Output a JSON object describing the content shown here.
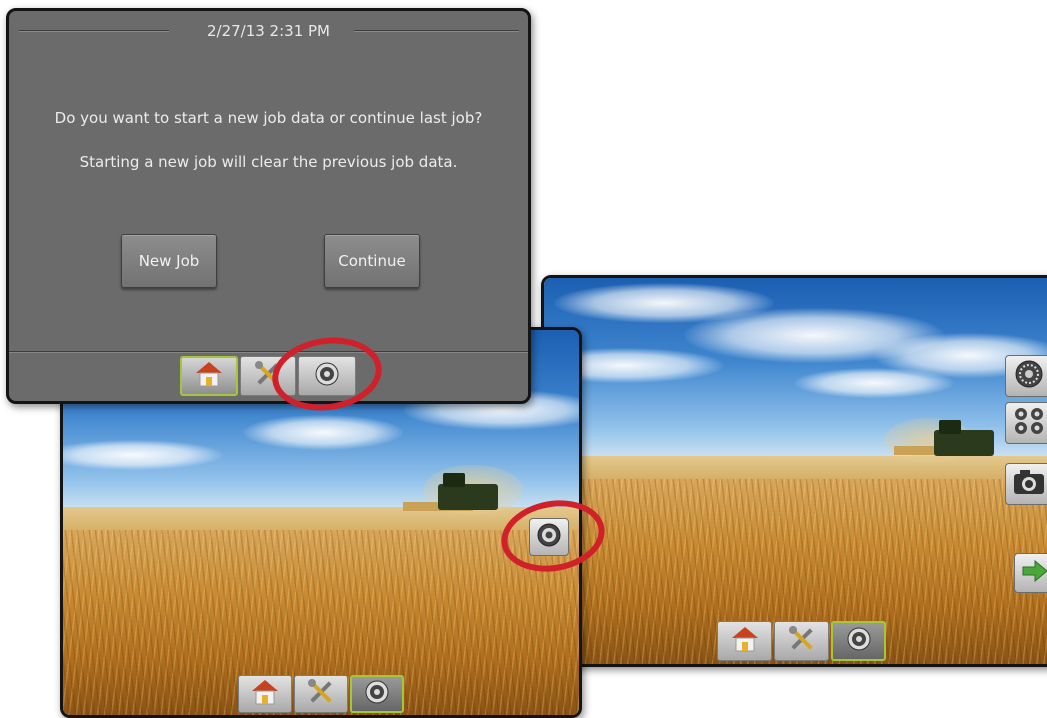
{
  "dialog": {
    "timestamp": "2/27/13 2:31 PM",
    "question": "Do you want to start a new job data or continue last job?",
    "warning": "Starting a new job will clear the previous job data.",
    "new_job_label": "New Job",
    "continue_label": "Continue"
  },
  "taskbar": {
    "items": [
      "home-icon",
      "tools-icon",
      "guidance-camera-icon"
    ],
    "active_color": "#a4c639"
  },
  "side_panel": {
    "items": [
      "guidance-camera-icon",
      "dual-camera-icon",
      "camera-icon",
      "next-arrow-icon"
    ]
  },
  "annotation": {
    "highlight_color": "#d0202a"
  }
}
